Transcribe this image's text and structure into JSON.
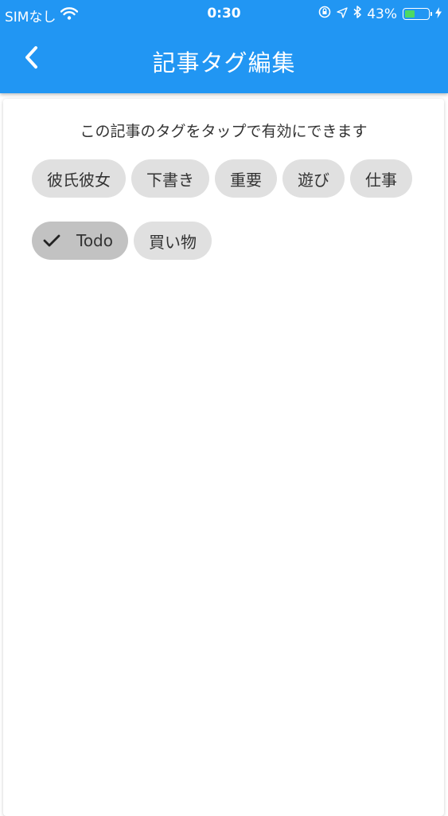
{
  "status_bar": {
    "carrier": "SIMなし",
    "time": "0:30",
    "battery_percent": "43%",
    "battery_level": 0.43,
    "icons": [
      "wifi-icon",
      "orientation-lock-icon",
      "location-icon",
      "bluetooth-icon",
      "battery-icon",
      "charging-icon"
    ]
  },
  "appbar": {
    "title": "記事タグ編集",
    "back_icon": "chevron-left-icon",
    "color": "#2196F3"
  },
  "main": {
    "hint": "この記事のタグをタップで有効にできます",
    "tags": [
      {
        "label": "彼氏彼女",
        "selected": false
      },
      {
        "label": "下書き",
        "selected": false
      },
      {
        "label": "重要",
        "selected": false
      },
      {
        "label": "遊び",
        "selected": false
      },
      {
        "label": "仕事",
        "selected": false
      },
      {
        "label": "Todo",
        "selected": true
      },
      {
        "label": "買い物",
        "selected": false
      }
    ]
  }
}
